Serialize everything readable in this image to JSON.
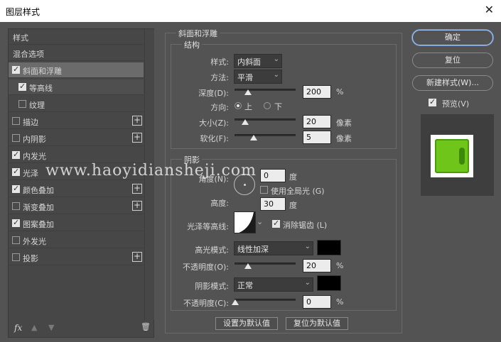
{
  "window": {
    "title": "图层样式",
    "close": "✕"
  },
  "left": {
    "header": "样式",
    "items": [
      {
        "label": "混合选项",
        "checkbox": false,
        "checked": false,
        "plus": false
      },
      {
        "label": "斜面和浮雕",
        "checkbox": true,
        "checked": true,
        "plus": false
      },
      {
        "label": "等高线",
        "checkbox": true,
        "checked": true,
        "plus": false,
        "indent": true
      },
      {
        "label": "纹理",
        "checkbox": true,
        "checked": false,
        "plus": false,
        "indent": true
      },
      {
        "label": "描边",
        "checkbox": true,
        "checked": false,
        "plus": true
      },
      {
        "label": "内阴影",
        "checkbox": true,
        "checked": false,
        "plus": true
      },
      {
        "label": "内发光",
        "checkbox": true,
        "checked": true,
        "plus": false
      },
      {
        "label": "光泽",
        "checkbox": true,
        "checked": true,
        "plus": false
      },
      {
        "label": "颜色叠加",
        "checkbox": true,
        "checked": true,
        "plus": true
      },
      {
        "label": "渐变叠加",
        "checkbox": true,
        "checked": false,
        "plus": true
      },
      {
        "label": "图案叠加",
        "checkbox": true,
        "checked": true,
        "plus": false
      },
      {
        "label": "外发光",
        "checkbox": true,
        "checked": false,
        "plus": false
      },
      {
        "label": "投影",
        "checkbox": true,
        "checked": false,
        "plus": true
      }
    ],
    "footer_fx": "fx"
  },
  "bevel": {
    "title": "斜面和浮雕",
    "structure": "结构",
    "style_label": "样式:",
    "style_value": "内斜面",
    "technique_label": "方法:",
    "technique_value": "平滑",
    "depth_label": "深度(D):",
    "depth_value": "200",
    "depth_unit": "%",
    "direction_label": "方向:",
    "dir_up": "上",
    "dir_down": "下",
    "size_label": "大小(Z):",
    "size_value": "20",
    "size_unit": "像素",
    "soften_label": "软化(F):",
    "soften_value": "5",
    "soften_unit": "像素"
  },
  "shading": {
    "title": "阴影",
    "angle_label": "角度(N):",
    "angle_value": "0",
    "angle_unit": "度",
    "global_light": "使用全局光 (G)",
    "altitude_label": "高度:",
    "altitude_value": "30",
    "altitude_unit": "度",
    "gloss_label": "光泽等高线:",
    "antialias": "消除锯齿 (L)",
    "highlight_label": "高光模式:",
    "highlight_value": "线性加深",
    "hl_opacity_label": "不透明度(O):",
    "hl_opacity_value": "20",
    "pct": "%",
    "shadow_label": "阴影模式:",
    "shadow_value": "正常",
    "sh_opacity_label": "不透明度(C):",
    "sh_opacity_value": "0"
  },
  "bottom": {
    "make_default": "设置为默认值",
    "reset_default": "复位为默认值"
  },
  "right": {
    "ok": "确定",
    "reset": "复位",
    "new_style": "新建样式(W)...",
    "preview": "预览(V)"
  },
  "watermark": "www.haoyidiansheji.com",
  "colors": {
    "preview_green": "#6fc51a",
    "bg": "#535353"
  }
}
